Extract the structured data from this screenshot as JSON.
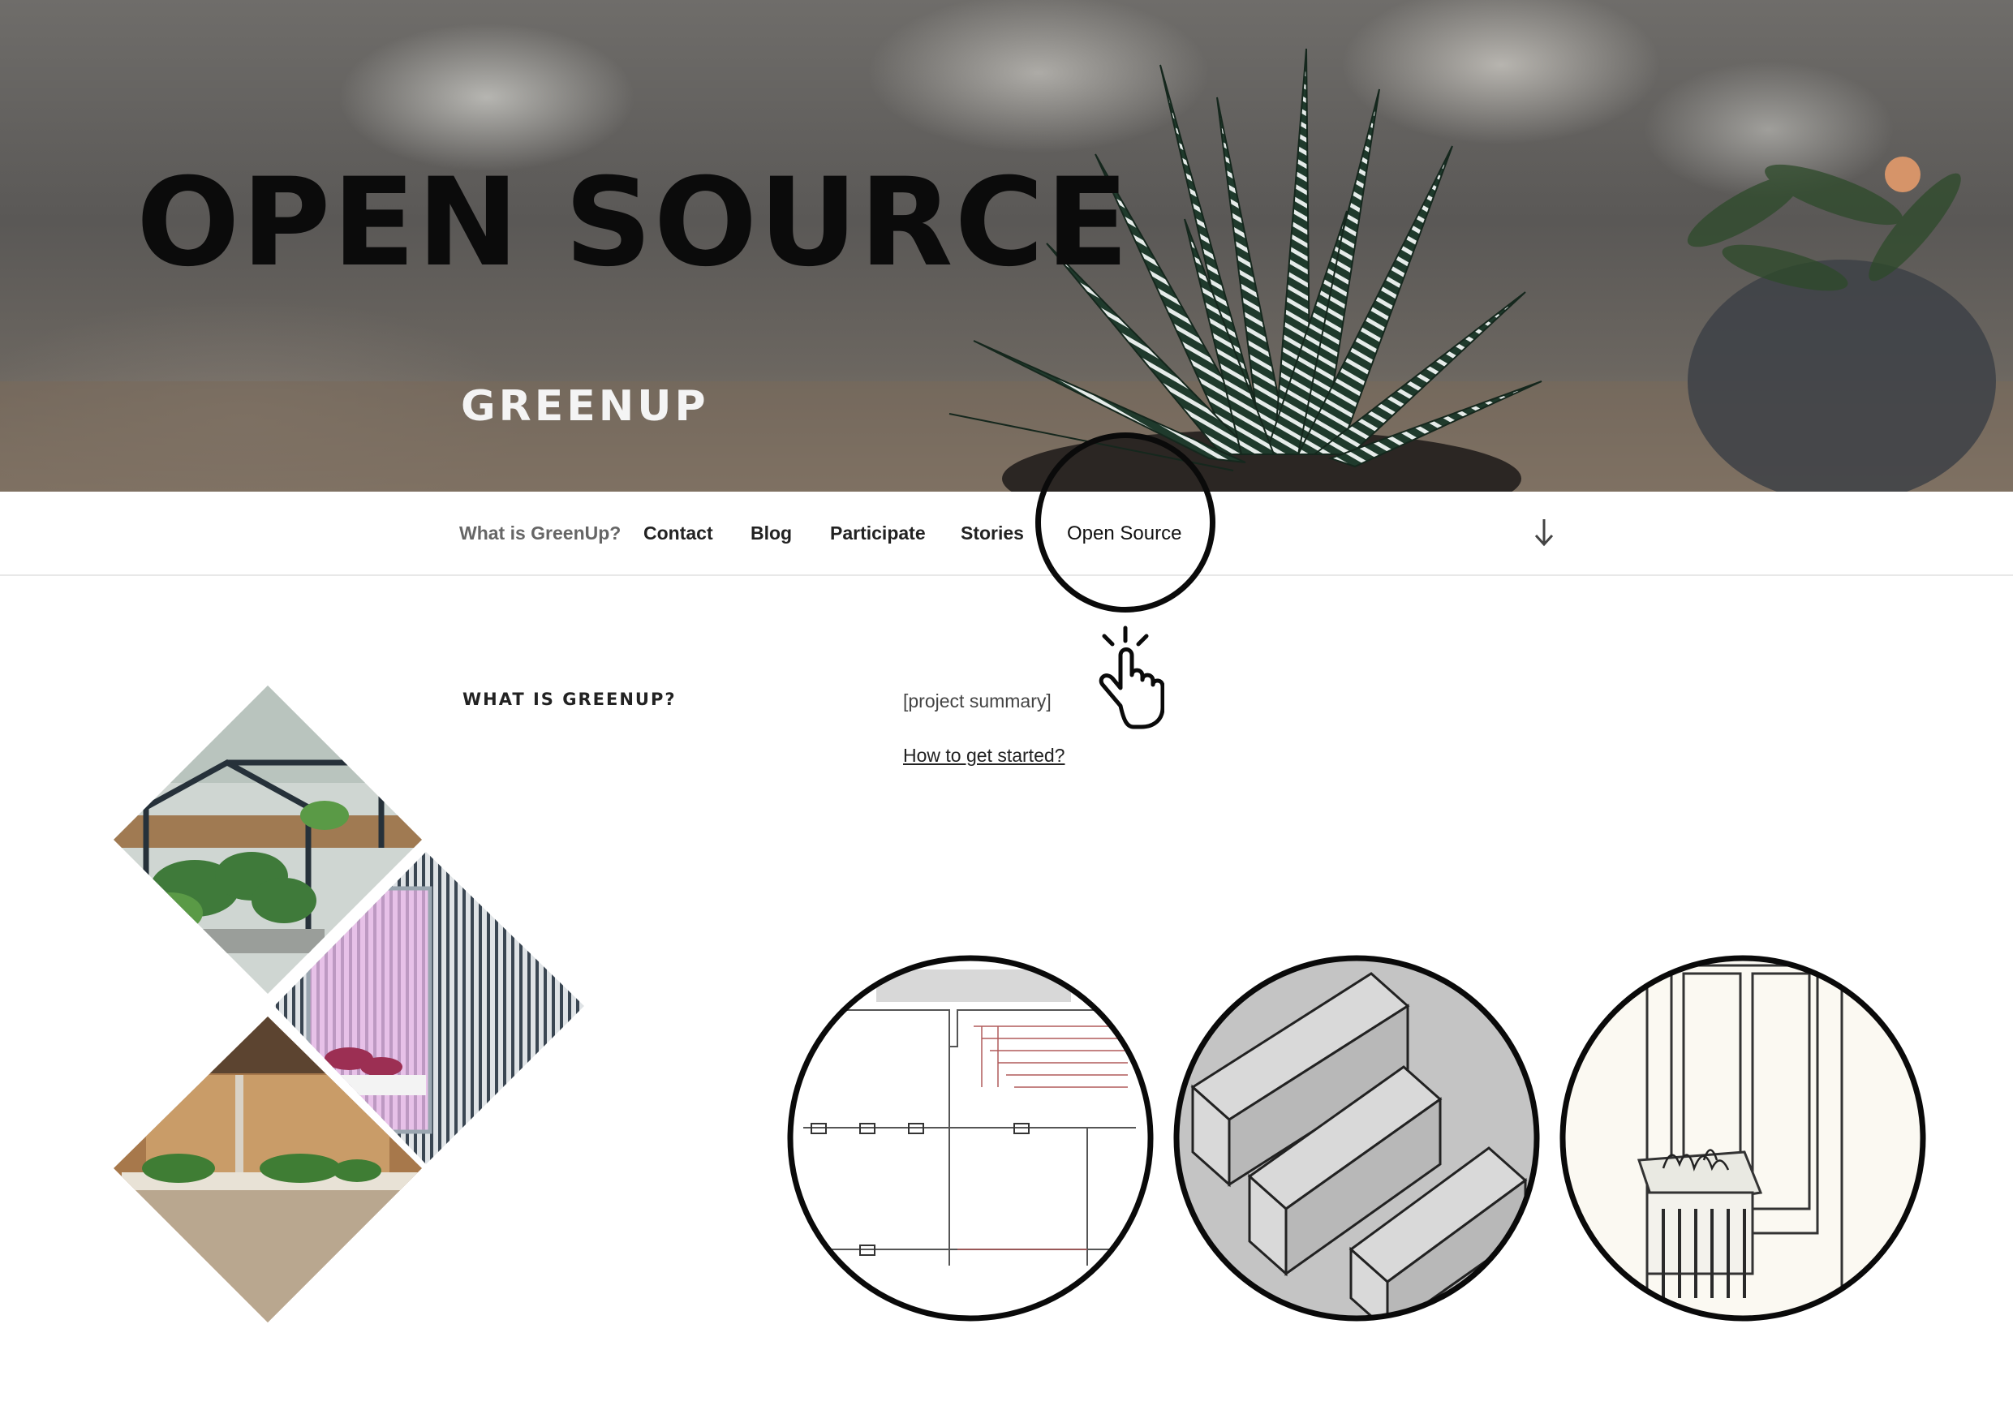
{
  "hero": {
    "title": "OPEN SOURCE",
    "site_title": "GREENUP"
  },
  "nav": {
    "items": [
      {
        "label": "What is GreenUp?",
        "state": "muted"
      },
      {
        "label": "Contact",
        "state": "normal"
      },
      {
        "label": "Blog",
        "state": "normal"
      },
      {
        "label": "Participate",
        "state": "normal"
      },
      {
        "label": "Stories",
        "state": "normal"
      },
      {
        "label": "Open Source",
        "state": "highlighted"
      }
    ],
    "scroll_icon": "arrow-down-icon"
  },
  "annotation": {
    "highlight": "circle-around-open-source",
    "cursor_icon": "pointing-hand-click-icon"
  },
  "content": {
    "heading": "WHAT IS GREENUP?",
    "summary": "[project summary]",
    "link": "How to get started?"
  },
  "gallery": {
    "mosaic_images": [
      "greenhouse-frame-planter",
      "pink-grow-light-cabinet",
      "stone-wall-shelf-planters"
    ],
    "circle_images": [
      "floor-plan-drawing",
      "planter-box-3d-models",
      "window-balcony-planter-drawing"
    ]
  },
  "colors": {
    "ink": "#0b0b0b",
    "nav_text": "#222222",
    "nav_muted": "#666666",
    "site_title": "#f4f4f4"
  }
}
